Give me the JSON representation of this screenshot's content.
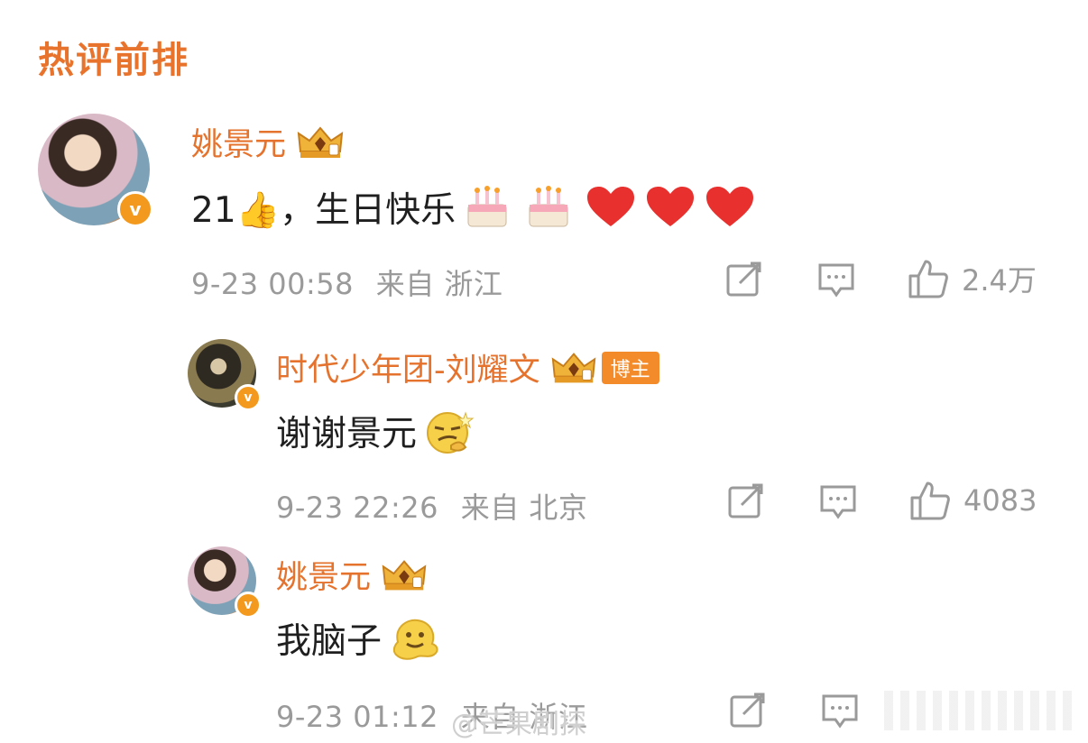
{
  "section_title": "热评前排",
  "comments": [
    {
      "author": "姚景元",
      "text": "21👍，生日快乐",
      "time": "9-23 00:58",
      "source": "来自 浙江",
      "likes": "2.4万"
    },
    {
      "author": "时代少年团-刘耀文",
      "badge": "博主",
      "text": "谢谢景元",
      "time": "9-23 22:26",
      "source": "来自 北京",
      "likes": "4083"
    },
    {
      "author": "姚景元",
      "text": "我脑子",
      "time": "9-23 01:12",
      "source": "来自 浙江",
      "likes": ""
    }
  ],
  "verified_mark": "v",
  "watermark": "@芒果剧探",
  "colors": {
    "accent": "#e8732c",
    "meta": "#9a9a9a",
    "heart": "#e8312f",
    "badge": "#f39a1e"
  },
  "icons": [
    "crown-icon",
    "thumbs-up-emoji",
    "cake-emoji",
    "heart-emoji",
    "smirk-emoji",
    "melting-face-emoji",
    "repost-icon",
    "comment-icon",
    "like-icon"
  ]
}
